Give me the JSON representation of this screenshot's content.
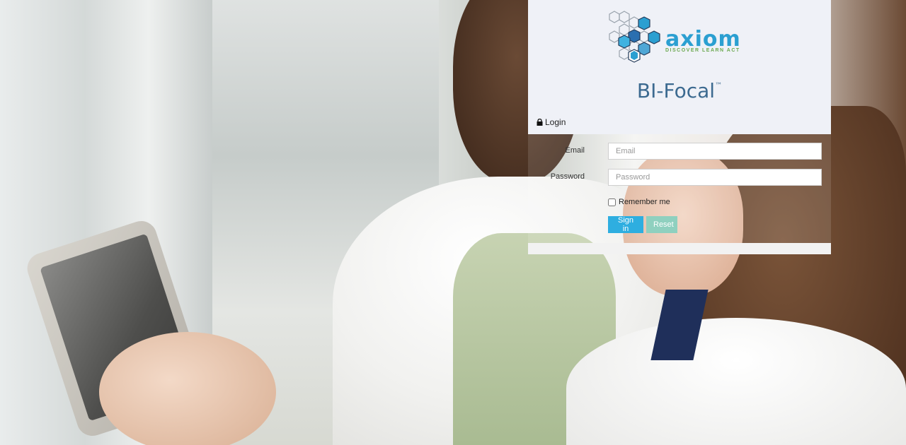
{
  "brand": {
    "logo_text": "axiom",
    "logo_tagline": "DISCOVER LEARN ACT",
    "product_name": "BI-Focal",
    "product_mark": "™"
  },
  "login": {
    "heading": "Login",
    "email_label": "Email",
    "email_placeholder": "Email",
    "password_label": "Password",
    "password_placeholder": "Password",
    "remember_label": "Remember me",
    "signin_label": "Sign in",
    "reset_label": "Reset"
  },
  "colors": {
    "panel_header_bg": "#eff1f7",
    "product_text": "#3c6a90",
    "logo_blue": "#2b9fd1",
    "signin_button": "#2eaee0",
    "reset_button": "#8fd0bf"
  },
  "icons": [
    "lock-icon",
    "hexagon-logo-icon"
  ]
}
